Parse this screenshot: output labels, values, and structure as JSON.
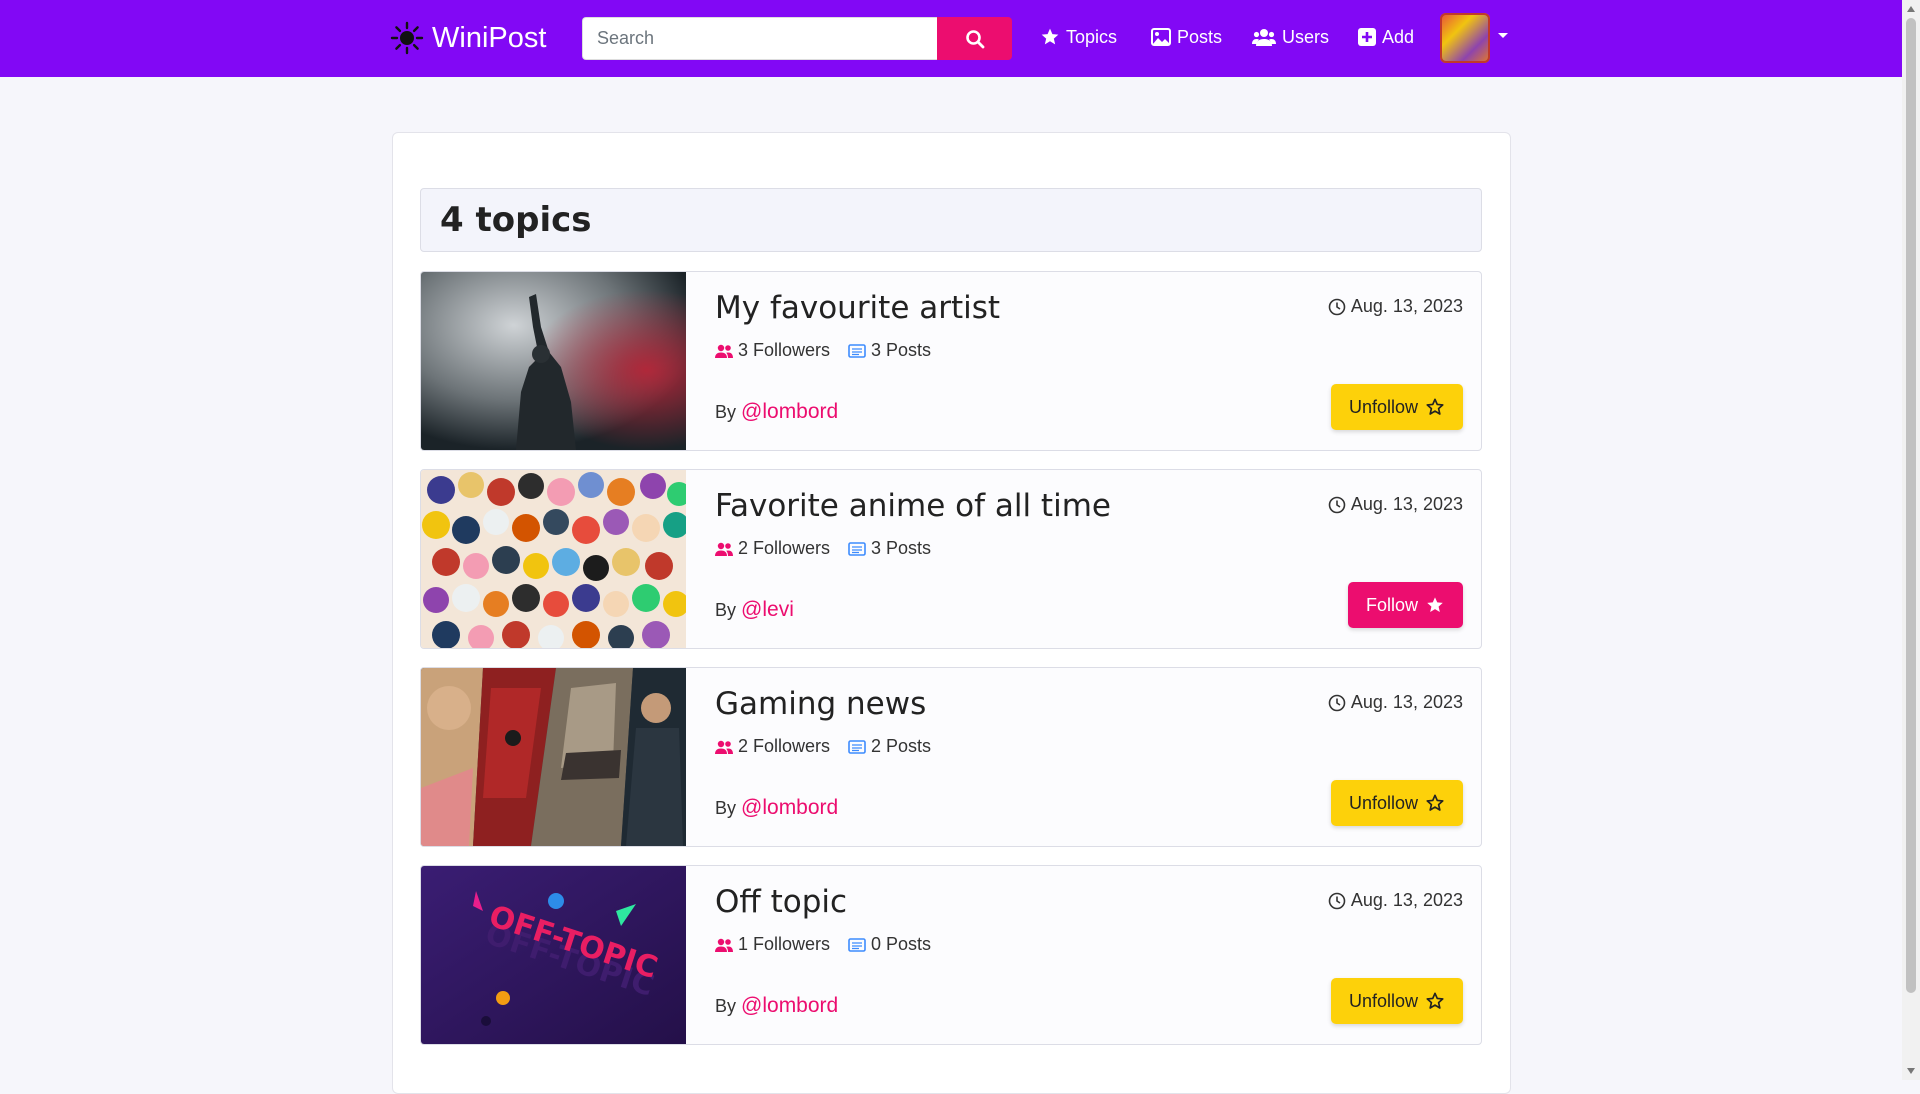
{
  "colors": {
    "nav_bg": "#8208f5",
    "accent": "#ec0d6f",
    "unfollow_bg": "#fdd10a"
  },
  "nav": {
    "brand": "WiniPost",
    "search_placeholder": "Search",
    "links": [
      {
        "label": "Topics",
        "icon": "star-icon"
      },
      {
        "label": "Posts",
        "icon": "image-icon"
      },
      {
        "label": "Users",
        "icon": "users-icon"
      },
      {
        "label": "Add",
        "icon": "plus-square-icon"
      }
    ]
  },
  "topics_heading": "4 topics",
  "topics": [
    {
      "title": "My favourite artist",
      "date": "Aug. 13, 2023",
      "followers": "3 Followers",
      "posts": "3 Posts",
      "by": "By",
      "author": "@lombord",
      "action": "Unfollow",
      "following": true
    },
    {
      "title": "Favorite anime of all time",
      "date": "Aug. 13, 2023",
      "followers": "2 Followers",
      "posts": "3 Posts",
      "by": "By",
      "author": "@levi",
      "action": "Follow",
      "following": false
    },
    {
      "title": "Gaming news",
      "date": "Aug. 13, 2023",
      "followers": "2 Followers",
      "posts": "2 Posts",
      "by": "By",
      "author": "@lombord",
      "action": "Unfollow",
      "following": true
    },
    {
      "title": "Off topic",
      "date": "Aug. 13, 2023",
      "followers": "1 Followers",
      "posts": "0 Posts",
      "by": "By",
      "author": "@lombord",
      "action": "Unfollow",
      "following": true
    }
  ]
}
